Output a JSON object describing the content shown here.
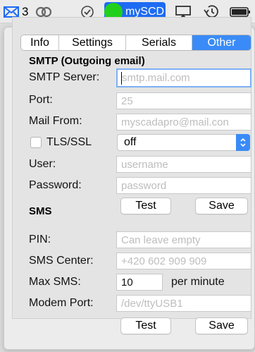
{
  "menubar": {
    "mail_count": "3",
    "app_name": "mySCD",
    "icons": [
      "mail-icon",
      "creative-cloud-icon",
      "checkmark-circle-icon",
      "status-dot-icon",
      "airplay-icon",
      "time-machine-icon",
      "battery-icon"
    ],
    "accent": "#1d6bf3",
    "status_color": "#22d01b"
  },
  "tabs": [
    {
      "label": "Info",
      "active": false
    },
    {
      "label": "Settings",
      "active": false
    },
    {
      "label": "Serials",
      "active": false
    },
    {
      "label": "Other",
      "active": true
    }
  ],
  "smtp": {
    "title": "SMTP (Outgoing email)",
    "server_label": "SMTP Server:",
    "server_placeholder": "smtp.mail.com",
    "port_label": "Port:",
    "port_placeholder": "25",
    "from_label": "Mail From:",
    "from_placeholder": "myscadapro@mail.con",
    "tls_label": "TLS/SSL",
    "tls_checked": false,
    "tls_value": "off",
    "user_label": "User:",
    "user_placeholder": "username",
    "password_label": "Password:",
    "password_placeholder": "password",
    "test_label": "Test",
    "save_label": "Save"
  },
  "sms": {
    "title": "SMS",
    "pin_label": "PIN:",
    "pin_placeholder": "Can leave empty",
    "center_label": "SMS Center:",
    "center_placeholder": "+420 602 909 909",
    "max_label": "Max SMS:",
    "max_value": "10",
    "max_unit": "per minute",
    "modem_label": "Modem Port:",
    "modem_placeholder": "/dev/ttyUSB1",
    "test_label": "Test",
    "save_label": "Save"
  }
}
